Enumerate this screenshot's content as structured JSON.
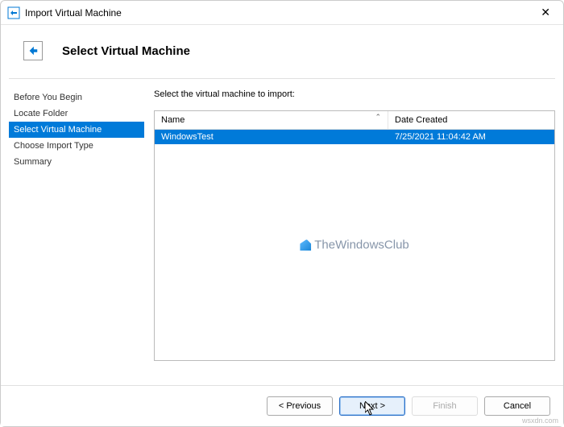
{
  "window": {
    "title": "Import Virtual Machine"
  },
  "header": {
    "heading": "Select Virtual Machine"
  },
  "sidebar": {
    "steps": [
      {
        "label": "Before You Begin"
      },
      {
        "label": "Locate Folder"
      },
      {
        "label": "Select Virtual Machine"
      },
      {
        "label": "Choose Import Type"
      },
      {
        "label": "Summary"
      }
    ]
  },
  "main": {
    "instruction": "Select the virtual machine to import:",
    "columns": {
      "name": "Name",
      "date": "Date Created"
    },
    "rows": [
      {
        "name": "WindowsTest",
        "date": "7/25/2021 11:04:42 AM"
      }
    ],
    "watermark": "TheWindowsClub"
  },
  "footer": {
    "previous": "< Previous",
    "next": "Next >",
    "finish": "Finish",
    "cancel": "Cancel"
  },
  "source": "wsxdn.com"
}
